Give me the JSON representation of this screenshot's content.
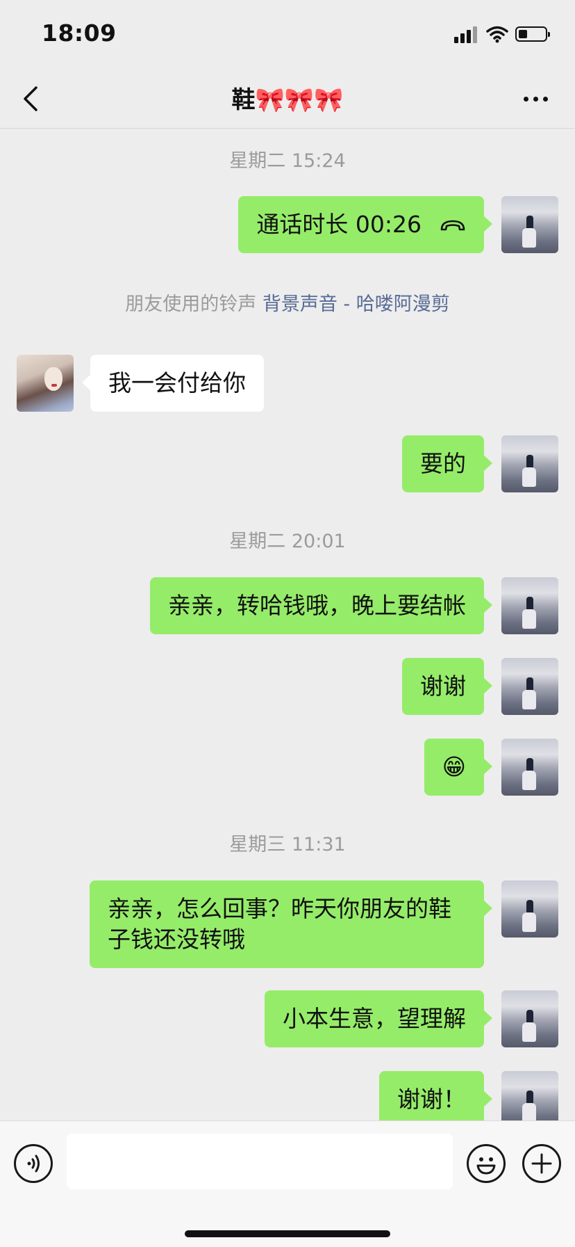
{
  "status_bar": {
    "time": "18:09"
  },
  "nav": {
    "title": "鞋🎀🎀🎀"
  },
  "chat": {
    "ts1": "星期二 15:24",
    "call_text": "通话时长 00:26",
    "ringtone_prefix": "朋友使用的铃声 ",
    "ringtone_link": "背景声音 - 哈喽阿漫剪",
    "msg_in_1": "我一会付给你",
    "msg_out_1": "要的",
    "ts2": "星期二 20:01",
    "msg_out_2": "亲亲，转哈钱哦，晚上要结帐",
    "msg_out_3": "谢谢",
    "msg_out_4": "😁",
    "ts3": "星期三 11:31",
    "msg_out_5": "亲亲，怎么回事？昨天你朋友的鞋子钱还没转哦",
    "msg_out_6": "小本生意，望理解",
    "msg_out_7": "谢谢！"
  },
  "input": {
    "value": "",
    "placeholder": ""
  }
}
